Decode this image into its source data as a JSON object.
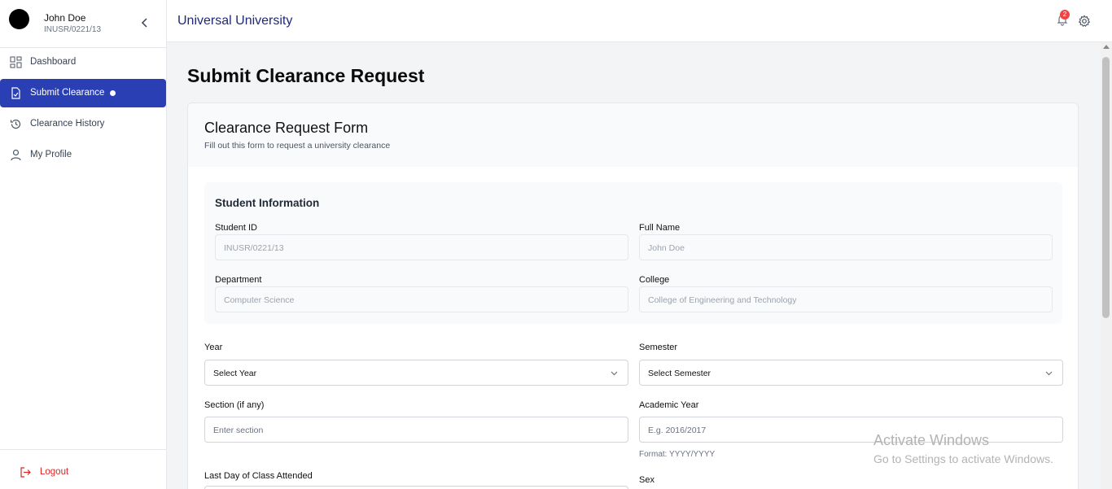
{
  "user": {
    "name": "John Doe",
    "id": "INUSR/0221/13"
  },
  "sidebar": {
    "items": [
      {
        "label": "Dashboard",
        "icon": "dashboard-icon"
      },
      {
        "label": "Submit Clearance",
        "icon": "file-check-icon",
        "active": true
      },
      {
        "label": "Clearance History",
        "icon": "history-icon"
      },
      {
        "label": "My Profile",
        "icon": "user-icon"
      }
    ],
    "logout": "Logout"
  },
  "topbar": {
    "brand": "Universal University",
    "notifications": "2"
  },
  "page": {
    "title": "Submit Clearance Request"
  },
  "form": {
    "title": "Clearance Request Form",
    "subtitle": "Fill out this form to request a university clearance",
    "student_info": {
      "title": "Student Information",
      "student_id_label": "Student ID",
      "student_id": "INUSR/0221/13",
      "full_name_label": "Full Name",
      "full_name": "John Doe",
      "department_label": "Department",
      "department": "Computer Science",
      "college_label": "College",
      "college": "College of Engineering and Technology"
    },
    "year_label": "Year",
    "year_value": "Select Year",
    "semester_label": "Semester",
    "semester_value": "Select Semester",
    "section_label": "Section (if any)",
    "section_placeholder": "Enter section",
    "academic_year_label": "Academic Year",
    "academic_year_placeholder": "E.g. 2016/2017",
    "academic_year_hint": "Format: YYYY/YYYY",
    "last_day_label": "Last Day of Class Attended",
    "sex_label": "Sex"
  },
  "watermark": {
    "line1": "Activate Windows",
    "line2": "Go to Settings to activate Windows."
  },
  "colors": {
    "accent": "#2a3fb3",
    "brand": "#1e2a78",
    "danger": "#dc2626"
  }
}
